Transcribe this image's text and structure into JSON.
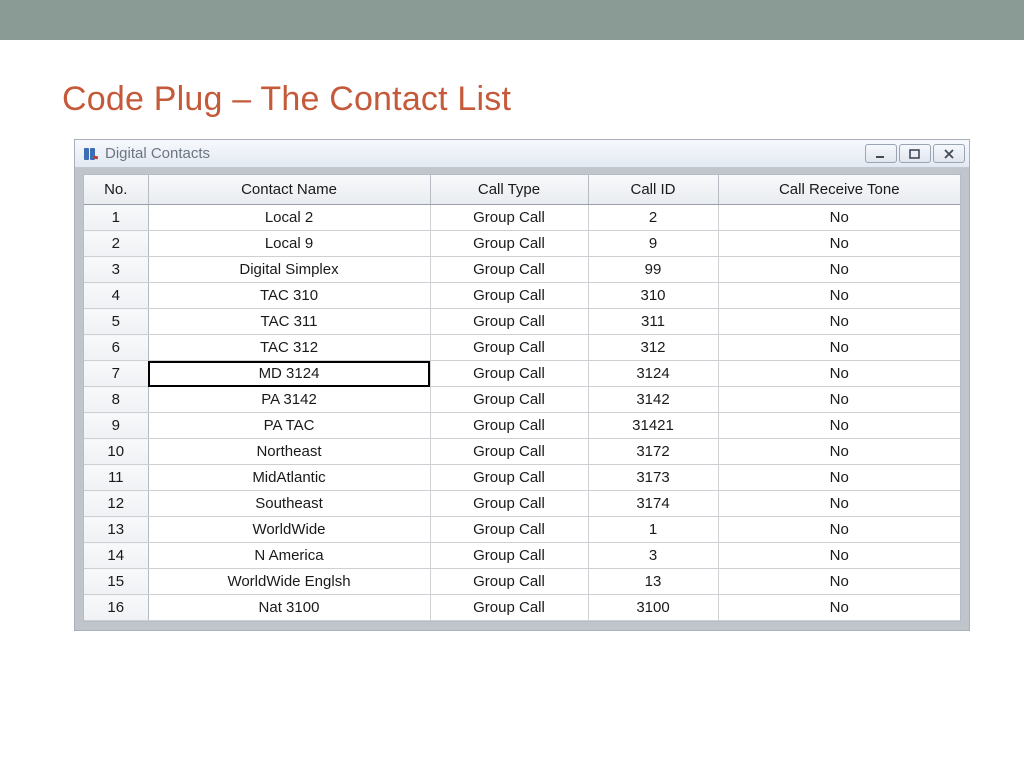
{
  "slide": {
    "heading": "Code Plug – The Contact List"
  },
  "window": {
    "title": "Digital Contacts"
  },
  "table": {
    "headers": {
      "no": "No.",
      "name": "Contact Name",
      "type": "Call Type",
      "id": "Call ID",
      "tone": "Call Receive Tone"
    },
    "selected_row_index": 6,
    "rows": [
      {
        "no": "1",
        "name": "Local 2",
        "type": "Group Call",
        "id": "2",
        "tone": "No"
      },
      {
        "no": "2",
        "name": "Local 9",
        "type": "Group Call",
        "id": "9",
        "tone": "No"
      },
      {
        "no": "3",
        "name": "Digital Simplex",
        "type": "Group Call",
        "id": "99",
        "tone": "No"
      },
      {
        "no": "4",
        "name": "TAC 310",
        "type": "Group Call",
        "id": "310",
        "tone": "No"
      },
      {
        "no": "5",
        "name": "TAC 311",
        "type": "Group Call",
        "id": "311",
        "tone": "No"
      },
      {
        "no": "6",
        "name": "TAC 312",
        "type": "Group Call",
        "id": "312",
        "tone": "No"
      },
      {
        "no": "7",
        "name": "MD 3124",
        "type": "Group Call",
        "id": "3124",
        "tone": "No"
      },
      {
        "no": "8",
        "name": "PA 3142",
        "type": "Group Call",
        "id": "3142",
        "tone": "No"
      },
      {
        "no": "9",
        "name": "PA TAC",
        "type": "Group Call",
        "id": "31421",
        "tone": "No"
      },
      {
        "no": "10",
        "name": "Northeast",
        "type": "Group Call",
        "id": "3172",
        "tone": "No"
      },
      {
        "no": "11",
        "name": "MidAtlantic",
        "type": "Group Call",
        "id": "3173",
        "tone": "No"
      },
      {
        "no": "12",
        "name": "Southeast",
        "type": "Group Call",
        "id": "3174",
        "tone": "No"
      },
      {
        "no": "13",
        "name": "WorldWide",
        "type": "Group Call",
        "id": "1",
        "tone": "No"
      },
      {
        "no": "14",
        "name": "N America",
        "type": "Group Call",
        "id": "3",
        "tone": "No"
      },
      {
        "no": "15",
        "name": "WorldWide Englsh",
        "type": "Group Call",
        "id": "13",
        "tone": "No"
      },
      {
        "no": "16",
        "name": "Nat 3100",
        "type": "Group Call",
        "id": "3100",
        "tone": "No"
      }
    ]
  }
}
